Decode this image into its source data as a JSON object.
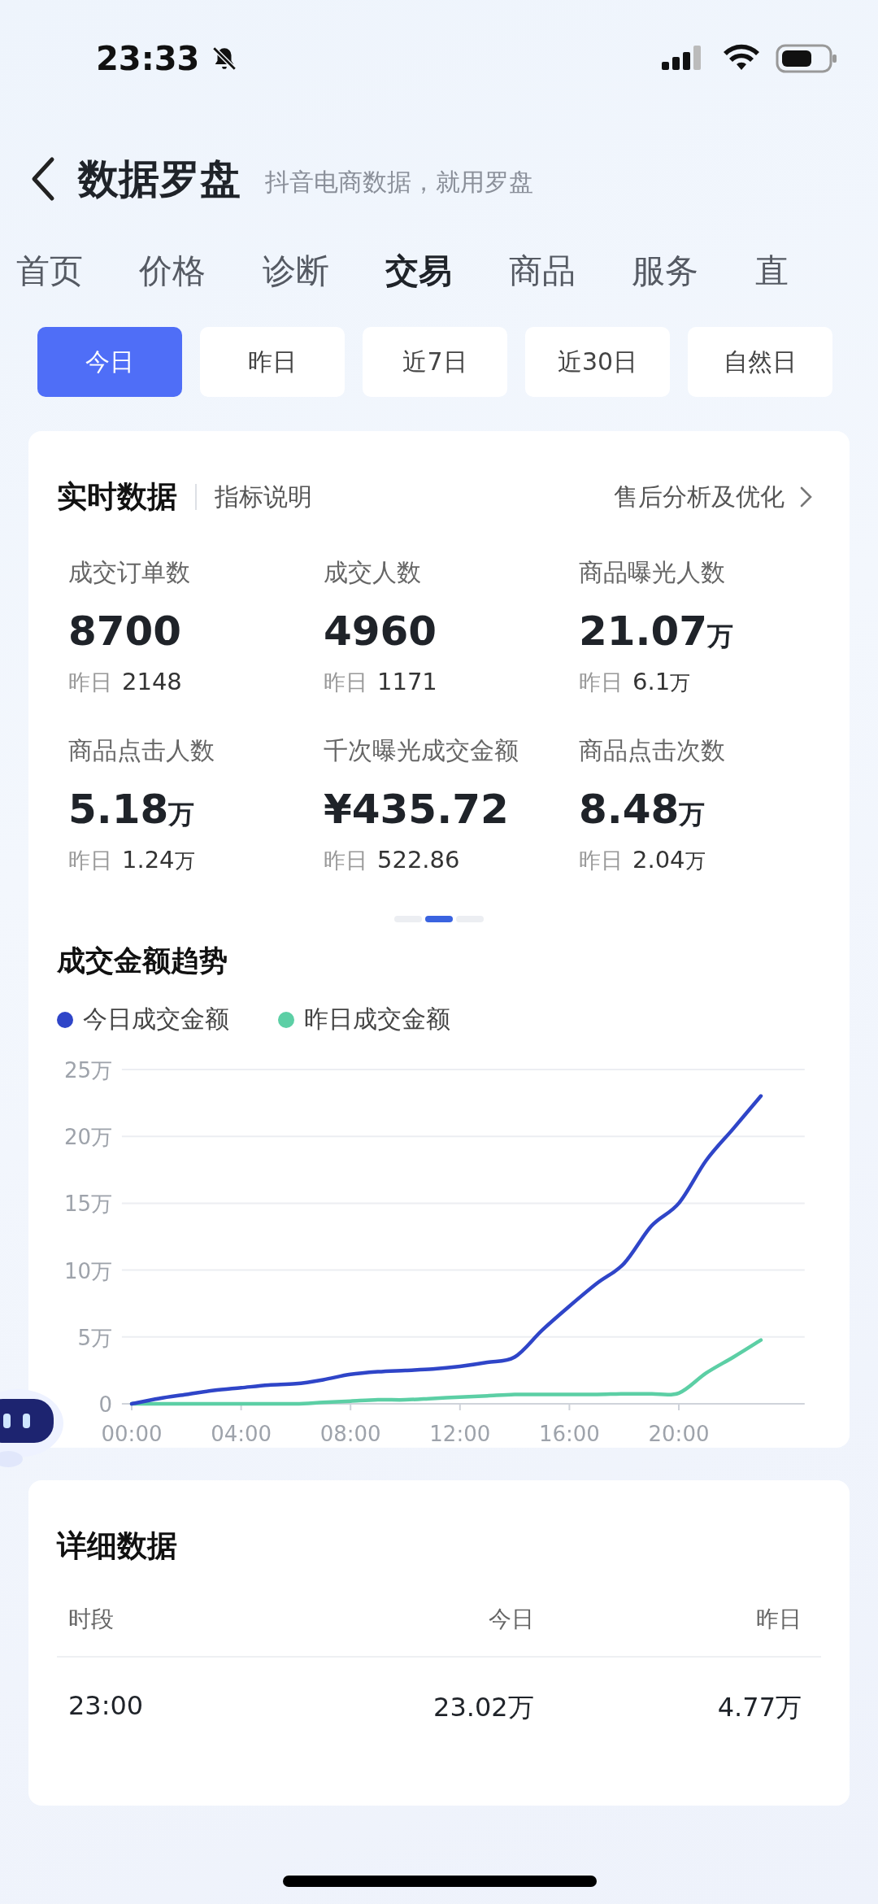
{
  "status_bar": {
    "time": "23:33"
  },
  "header": {
    "title": "数据罗盘",
    "subtitle": "抖音电商数据，就用罗盘"
  },
  "tabs": [
    {
      "label": "首页",
      "selected": false
    },
    {
      "label": "价格",
      "selected": false
    },
    {
      "label": "诊断",
      "selected": false
    },
    {
      "label": "交易",
      "selected": true
    },
    {
      "label": "商品",
      "selected": false
    },
    {
      "label": "服务",
      "selected": false
    },
    {
      "label": "直",
      "selected": false
    }
  ],
  "date_filters": [
    {
      "label": "今日",
      "selected": true
    },
    {
      "label": "昨日",
      "selected": false
    },
    {
      "label": "近7日",
      "selected": false
    },
    {
      "label": "近30日",
      "selected": false
    },
    {
      "label": "自然日",
      "selected": false
    }
  ],
  "realtime": {
    "title": "实时数据",
    "help_link": "指标说明",
    "action_link": "售后分析及优化",
    "metrics": [
      {
        "label": "成交订单数",
        "value": "8700",
        "yesterday_label": "昨日",
        "yesterday": "2148"
      },
      {
        "label": "成交人数",
        "value": "4960",
        "yesterday_label": "昨日",
        "yesterday": "1171"
      },
      {
        "label": "商品曝光人数",
        "value": "21.07",
        "unit": "万",
        "yesterday_label": "昨日",
        "yesterday": "6.1",
        "yesterday_unit": "万"
      },
      {
        "label": "商品点击人数",
        "value": "5.18",
        "unit": "万",
        "yesterday_label": "昨日",
        "yesterday": "1.24",
        "yesterday_unit": "万"
      },
      {
        "label": "千次曝光成交金额",
        "value": "¥435.72",
        "yesterday_label": "昨日",
        "yesterday": "522.86"
      },
      {
        "label": "商品点击次数",
        "value": "8.48",
        "unit": "万",
        "yesterday_label": "昨日",
        "yesterday": "2.04",
        "yesterday_unit": "万"
      }
    ],
    "pages": [
      {
        "selected": false
      },
      {
        "selected": true
      },
      {
        "selected": false
      }
    ],
    "trend": {
      "title": "成交金额趋势",
      "chart_data": {
        "type": "line",
        "x": [
          0,
          1,
          2,
          3,
          4,
          5,
          6,
          7,
          8,
          9,
          10,
          11,
          12,
          13,
          14,
          15,
          16,
          17,
          18,
          19,
          20,
          21,
          22,
          23
        ],
        "xlim": [
          -0.36,
          24.6
        ],
        "grid": true,
        "series": [
          {
            "name": "今日成交金额",
            "color": "#2f45c8",
            "values": [
              0,
              0.4,
              0.7,
              1.0,
              1.2,
              1.4,
              1.5,
              1.8,
              2.2,
              2.4,
              2.5,
              2.6,
              2.8,
              3.1,
              3.5,
              5.5,
              7.3,
              9.0,
              10.5,
              13.3,
              15.0,
              18.2,
              20.6,
              23.02
            ]
          },
          {
            "name": "昨日成交金额",
            "color": "#5ccfa5",
            "values": [
              0,
              0,
              0,
              0,
              0,
              0,
              0,
              0.1,
              0.2,
              0.3,
              0.3,
              0.4,
              0.5,
              0.6,
              0.7,
              0.7,
              0.7,
              0.7,
              0.75,
              0.75,
              0.8,
              2.3,
              3.5,
              4.77
            ]
          }
        ],
        "ylim": [
          0,
          25
        ],
        "yticks": [
          {
            "value": 0,
            "label": "0"
          },
          {
            "value": 5,
            "label": "5万"
          },
          {
            "value": 10,
            "label": "10万"
          },
          {
            "value": 15,
            "label": "15万"
          },
          {
            "value": 20,
            "label": "20万"
          },
          {
            "value": 25,
            "label": "25万"
          }
        ],
        "xticks": [
          {
            "value": 0,
            "label": "00:00"
          },
          {
            "value": 4,
            "label": "04:00"
          },
          {
            "value": 8,
            "label": "08:00"
          },
          {
            "value": 12,
            "label": "12:00"
          },
          {
            "value": 16,
            "label": "16:00"
          },
          {
            "value": 20,
            "label": "20:00"
          }
        ]
      }
    }
  },
  "details": {
    "title": "详细数据",
    "columns": [
      "时段",
      "今日",
      "昨日"
    ],
    "rows": [
      [
        "23:00",
        "23.02万",
        "4.77万"
      ]
    ]
  }
}
